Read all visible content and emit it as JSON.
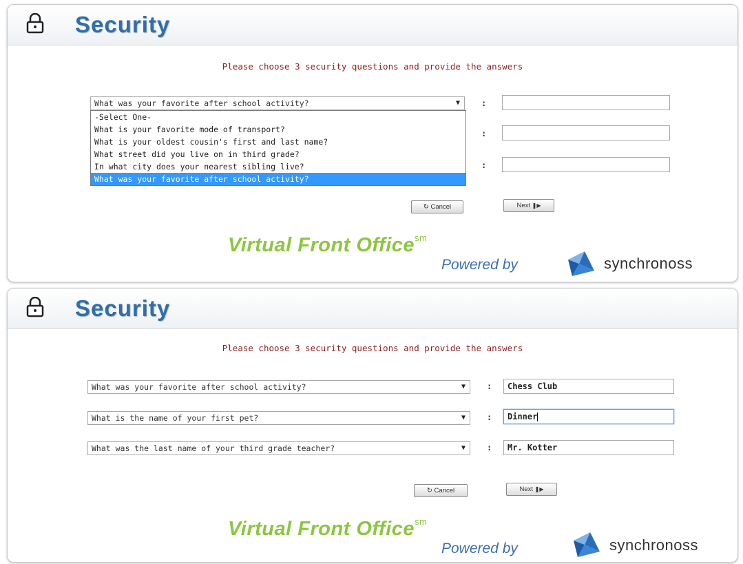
{
  "header": {
    "title": "Security",
    "icon": "lock-icon"
  },
  "instructions": "Please choose 3 security questions and provide the answers",
  "panel1": {
    "question1": {
      "value": "What was your favorite after school activity?",
      "answer": ""
    },
    "answer2": "",
    "answer3": "",
    "dropdown_options": [
      "-Select One-",
      "What is your favorite mode of transport?",
      "What is your oldest cousin's first and last name?",
      "What street did you live on in third grade?",
      "In what city does your nearest sibling live?",
      "What was your favorite after school activity?"
    ],
    "highlighted_option_index": 5
  },
  "panel2": {
    "questions": [
      {
        "value": "What was your favorite after school activity?",
        "answer": "Chess Club"
      },
      {
        "value": "What is the name of your first pet?",
        "answer": "Dinner"
      },
      {
        "value": "What was the last name of your third grade teacher?",
        "answer": "Mr. Kotter"
      }
    ]
  },
  "colon": ":",
  "buttons": {
    "cancel": "Cancel",
    "cancel_icon": "↻",
    "next": "Next",
    "next_icon": "❚▶"
  },
  "branding": {
    "product": "Virtual Front Office",
    "sm": "sm",
    "powered_by": "Powered by",
    "company": "synchronoss"
  },
  "colors": {
    "title": "#2f6faa",
    "instructions": "#8b1f1f",
    "highlight": "#3399ff",
    "brand_green": "#8cc63f",
    "powered_blue": "#3b6fb0"
  }
}
